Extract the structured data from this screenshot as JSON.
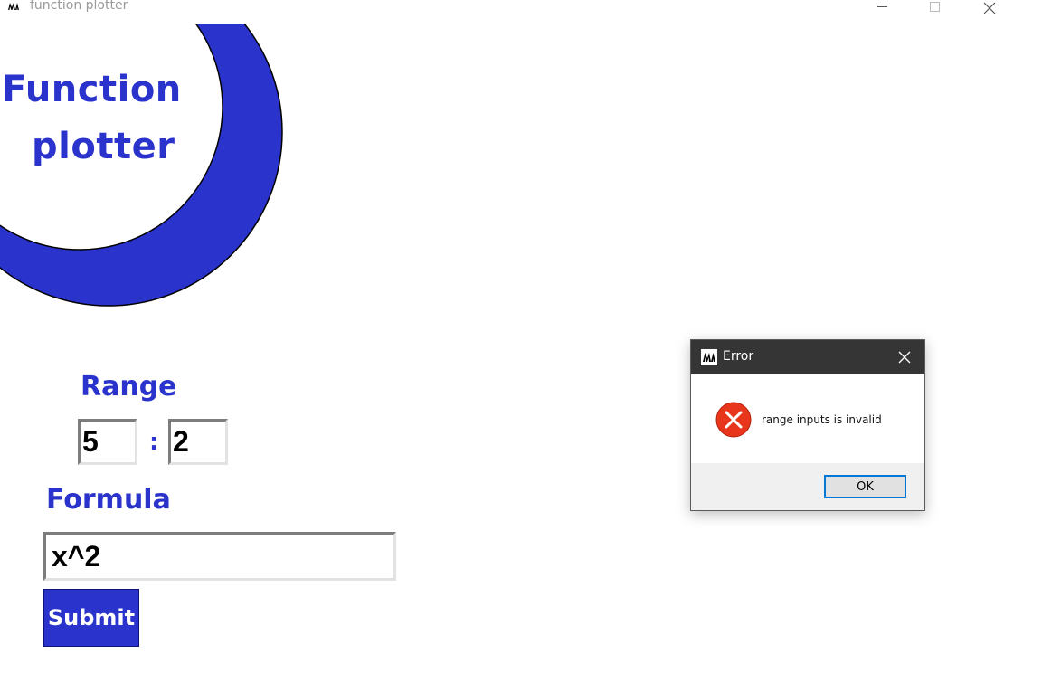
{
  "window": {
    "title": "function plotter",
    "app_icon": "app-logo-icon",
    "controls": [
      "minimize-icon",
      "maximize-icon",
      "close-icon"
    ]
  },
  "logo": {
    "line1": "Function",
    "line2": "plotter",
    "color": "#2a33cc"
  },
  "form": {
    "range_label": "Range",
    "range_from_value": "5",
    "range_separator": ":",
    "range_to_value": "2",
    "formula_label": "Formula",
    "formula_value": "x^2",
    "submit_label": "Submit"
  },
  "dialog": {
    "title": "Error",
    "icon": "error-icon",
    "message": "range inputs is invalid",
    "ok_label": "OK",
    "accent_color": "#0078d7",
    "error_color": "#e8361c"
  },
  "colors": {
    "brand": "#2a33cc",
    "dialog_titlebar": "#353535"
  }
}
